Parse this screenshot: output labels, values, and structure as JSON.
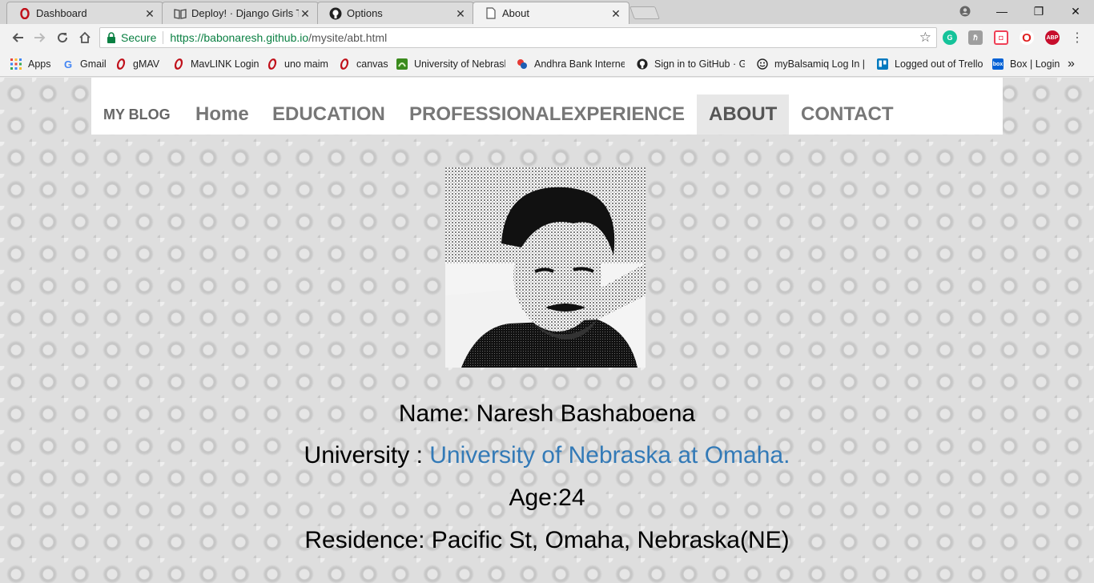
{
  "browser": {
    "tabs": [
      {
        "title": "Dashboard",
        "icon": "opera-o-icon",
        "close": "✕"
      },
      {
        "title": "Deploy! · Django Girls Tut",
        "icon": "book-icon",
        "close": "✕"
      },
      {
        "title": "Options",
        "icon": "github-icon",
        "close": "✕"
      },
      {
        "title": "About",
        "icon": "page-icon",
        "close": "✕"
      }
    ],
    "window_controls": {
      "minimize": "—",
      "restore": "❐",
      "close": "✕"
    },
    "address": {
      "secure_label": "Secure",
      "url_host": "https://babonaresh.github.io",
      "url_path": "/mysite/abt.html"
    },
    "extensions": [
      {
        "name": "grammarly-extension-icon",
        "glyph": "G",
        "color": "#15c39a"
      },
      {
        "name": "extension-puzzle-icon",
        "glyph": "ℏ",
        "color": "#9e9e9e"
      },
      {
        "name": "pocket-extension-icon",
        "glyph": "◘",
        "color": "#ef4056"
      },
      {
        "name": "opera-extension-icon",
        "glyph": "O",
        "color": "#e01e1e"
      },
      {
        "name": "adblock-plus-extension-icon",
        "glyph": "ABP",
        "color": "#c70d2c"
      }
    ],
    "bookmarks": [
      {
        "label": "Apps",
        "icon": "apps-grid-icon"
      },
      {
        "label": "Gmail",
        "icon": "google-g-icon"
      },
      {
        "label": "gMAV",
        "icon": "opera-o-icon"
      },
      {
        "label": "MavLINK Login",
        "icon": "opera-o-icon"
      },
      {
        "label": "uno maim",
        "icon": "opera-o-icon"
      },
      {
        "label": "canvas",
        "icon": "opera-o-icon"
      },
      {
        "label": "University of Nebrask",
        "icon": "green-square-icon"
      },
      {
        "label": "Andhra Bank Internet",
        "icon": "andhra-bank-icon"
      },
      {
        "label": "Sign in to GitHub · Gi",
        "icon": "github-icon"
      },
      {
        "label": "myBalsamiq Log In | ",
        "icon": "smiley-icon"
      },
      {
        "label": "Logged out of Trello",
        "icon": "trello-icon"
      },
      {
        "label": "Box | Login",
        "icon": "box-icon"
      }
    ],
    "bookmarks_overflow": "»"
  },
  "site": {
    "brand": "MY BLOG",
    "nav": [
      {
        "label": "Home",
        "active": false
      },
      {
        "label": "EDUCATION",
        "active": false
      },
      {
        "label": "PROFESSIONALEXPERIENCE",
        "active": false
      },
      {
        "label": "ABOUT",
        "active": true
      },
      {
        "label": "CONTACT",
        "active": false
      }
    ],
    "profile": {
      "name_line": "Name: Naresh Bashaboena",
      "university_prefix": "University : ",
      "university_link": "University of Nebraska at Omaha.",
      "age_line": "Age:24",
      "residence_line": "Residence: Pacific St, Omaha, Nebraska(NE)"
    }
  },
  "colors": {
    "link": "#337ab7",
    "secure_green": "#0b8043",
    "nav_text": "#777777",
    "nav_active_bg": "#e7e7e7"
  }
}
